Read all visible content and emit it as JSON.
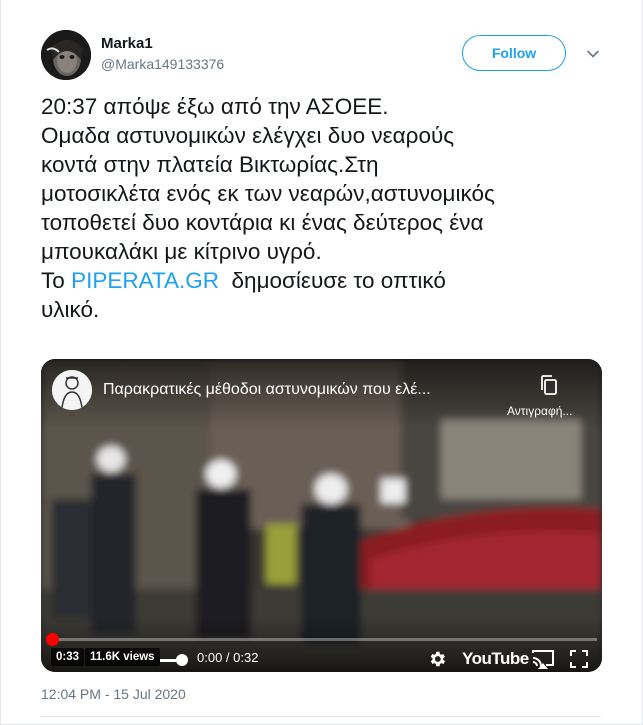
{
  "author": {
    "display_name": "Marka1",
    "handle": "@Marka149133376",
    "follow_label": "Follow",
    "avatar_icon": "dark-portrait-avatar"
  },
  "tweet": {
    "lines": [
      "20:37 απόψε έξω από την ΑΣΟΕΕ.",
      "Ομαδα αστυνομικών ελέγχει δυο νεαρούς",
      "κοντά στην πλατεία Βικτωρίας.Στη",
      "μοτοσικλέτα ενός εκ των νεαρών,αστυνομικός",
      "τοποθετεί δυο κοντάρια κι ένας δεύτερος ένα",
      "μπουκαλάκι με κίτρινο υγρό."
    ],
    "last_prefix": "Το",
    "link_text": "PIPERATA.GR",
    "last_suffix": "δημοσίευσε το οπτικό",
    "last_line": "υλικό.",
    "timestamp": "12:04 PM - 15 Jul 2020"
  },
  "video": {
    "title": "Παρακρατικές μέθοδοι αστυνομικών που ελέ...",
    "copy_label": "Αντιγραφή...",
    "duration_badge": "0:33",
    "views_badge": "11.6K views",
    "time_display": "0:00 / 0:32",
    "brand": "YouTube",
    "progress": 0.0,
    "icons": [
      "channel-avatar",
      "copy-icon",
      "gear-icon",
      "cast-icon",
      "fullscreen-icon"
    ]
  },
  "colors": {
    "accent": "#1da1f2",
    "muted": "#657786",
    "progress": "#ff0000"
  }
}
